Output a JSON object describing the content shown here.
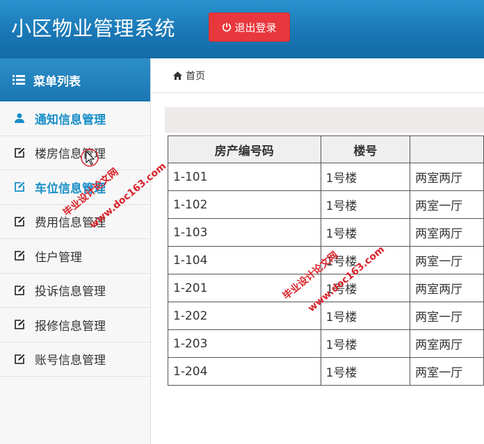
{
  "header": {
    "app_title": "小区物业管理系统",
    "logout_label": "退出登录",
    "logout_icon": "power-icon"
  },
  "sidebar": {
    "title": "菜单列表",
    "title_icon": "list-icon",
    "items": [
      {
        "label": "通知信息管理",
        "icon": "user-icon",
        "active": true
      },
      {
        "label": "楼房信息管理",
        "icon": "edit-icon",
        "active": false
      },
      {
        "label": "车位信息管理",
        "icon": "edit-icon",
        "active": true
      },
      {
        "label": "费用信息管理",
        "icon": "edit-icon",
        "active": false
      },
      {
        "label": "住户管理",
        "icon": "edit-icon",
        "active": false
      },
      {
        "label": "投诉信息管理",
        "icon": "edit-icon",
        "active": false
      },
      {
        "label": "报修信息管理",
        "icon": "edit-icon",
        "active": false
      },
      {
        "label": "账号信息管理",
        "icon": "edit-icon",
        "active": false
      }
    ]
  },
  "breadcrumb": {
    "home_label": "首页",
    "icon": "home-icon"
  },
  "table": {
    "headers": [
      "房产编号码",
      "楼号",
      ""
    ],
    "rows": [
      [
        "1-101",
        "1号楼",
        "两室两厅"
      ],
      [
        "1-102",
        "1号楼",
        "两室一厅"
      ],
      [
        "1-103",
        "1号楼",
        "两室两厅"
      ],
      [
        "1-104",
        "1号楼",
        "两室一厅"
      ],
      [
        "1-201",
        "1号楼",
        "两室两厅"
      ],
      [
        "1-202",
        "1号楼",
        "两室一厅"
      ],
      [
        "1-203",
        "1号楼",
        "两室两厅"
      ],
      [
        "1-204",
        "1号楼",
        "两室一厅"
      ]
    ]
  },
  "watermarks": {
    "w1_text": "毕业设计论文网",
    "w1_url": "www.doc163.com",
    "w2_text": "毕业设计论文网",
    "w2_url": "www.doc163.com"
  },
  "colors": {
    "header_blue": "#1a78b6",
    "accent": "#1a8fc8",
    "logout_red": "#e8383d"
  }
}
